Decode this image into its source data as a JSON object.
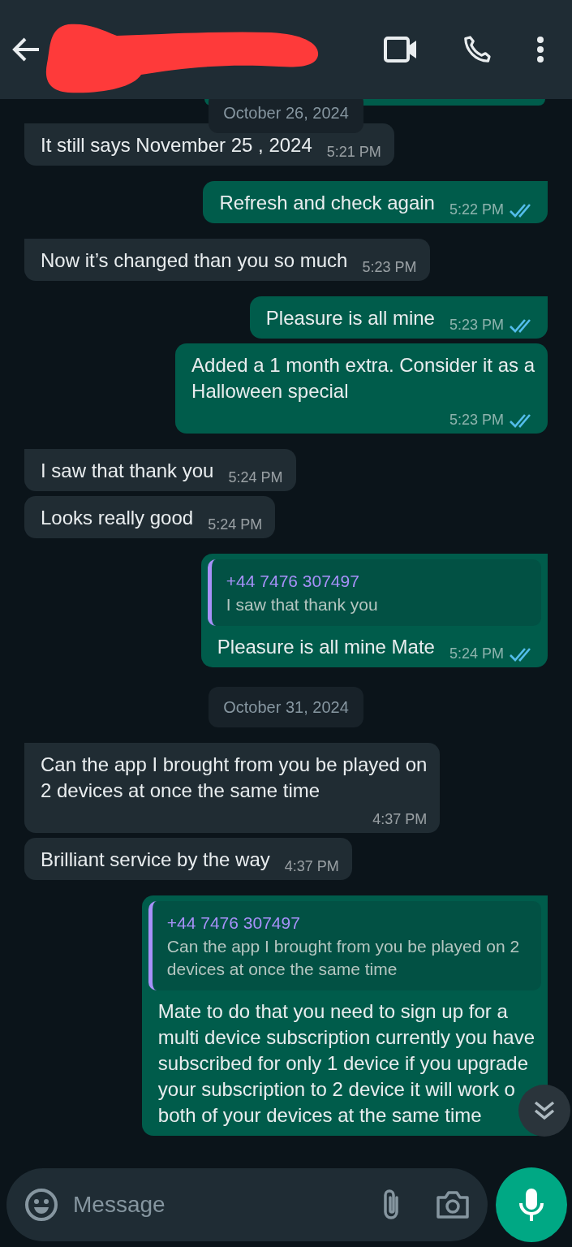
{
  "header": {
    "name_redacted": true
  },
  "floating_date": "October 26, 2024",
  "messages": [
    {
      "kind": "cut_off"
    },
    {
      "kind": "incoming",
      "text": "It still says November 25 , 2024",
      "time": "5:21 PM"
    },
    {
      "kind": "outgoing",
      "text": "Refresh and check again",
      "time": "5:22 PM",
      "read": true
    },
    {
      "kind": "incoming",
      "text": "Now it’s changed than you so much",
      "time": "5:23 PM"
    },
    {
      "kind": "outgoing",
      "text": "Pleasure is all mine",
      "time": "5:23 PM",
      "read": true
    },
    {
      "kind": "outgoing",
      "text": "Added a 1 month extra. Consider it as a\nHalloween special",
      "time": "5:23 PM",
      "read": true
    },
    {
      "kind": "incoming",
      "text": "I saw that thank you",
      "time": "5:24 PM"
    },
    {
      "kind": "incoming",
      "text": "Looks really good",
      "time": "5:24 PM"
    },
    {
      "kind": "outgoing",
      "quote": {
        "author": "+44 7476 307497",
        "text": "I saw that thank you"
      },
      "text": "Pleasure is all mine Mate",
      "time": "5:24 PM",
      "read": true
    },
    {
      "kind": "date",
      "text": "October 31, 2024"
    },
    {
      "kind": "incoming",
      "text": "Can the app I brought from you be played on\n2 devices at once the same time",
      "time": "4:37 PM"
    },
    {
      "kind": "incoming",
      "text": "Brilliant  service by the way",
      "time": "4:37 PM"
    },
    {
      "kind": "outgoing",
      "quote": {
        "author": "+44 7476 307497",
        "text": "Can the app I brought from you be played on 2\ndevices at once the same time"
      },
      "text": "Mate to do that you need to sign up for a\nmulti device subscription currently you have\nsubscribed for only 1 device if you upgrade\nyour subscription to 2 device it will work o\nboth of your devices at the same time"
    }
  ],
  "composer": {
    "placeholder": "Message"
  }
}
